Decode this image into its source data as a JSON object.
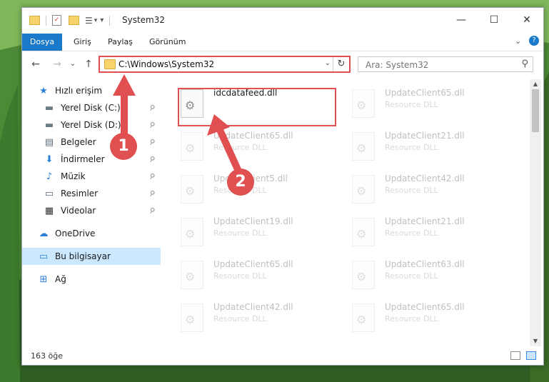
{
  "window": {
    "title": "System32",
    "controls": {
      "minimize": "—",
      "maximize": "☐",
      "close": "✕"
    }
  },
  "ribbon": {
    "tabs": [
      "Dosya",
      "Giriş",
      "Paylaş",
      "Görünüm"
    ],
    "expand_glyph": "⌄",
    "help_glyph": "?"
  },
  "address": {
    "path": "C:\\Windows\\System32",
    "dropdown_glyph": "⌄",
    "refresh_glyph": "↻"
  },
  "nav": {
    "back": "←",
    "forward": "→",
    "recent": "⌄",
    "up": "↑"
  },
  "search": {
    "placeholder": "Ara: System32",
    "icon": "⚲"
  },
  "sidebar": {
    "items": [
      {
        "label": "Hızlı erişim",
        "icon": "star-icon",
        "glyph": "★",
        "color": "#2b7fd6"
      },
      {
        "label": "Yerel Disk (C:)",
        "icon": "drive-icon",
        "glyph": "▬",
        "color": "#6b7b86",
        "pinned": true
      },
      {
        "label": "Yerel Disk (D:)",
        "icon": "drive-icon",
        "glyph": "▬",
        "color": "#6b7b86",
        "pinned": true
      },
      {
        "label": "Belgeler",
        "icon": "documents-icon",
        "glyph": "▤",
        "color": "#5a6b7a",
        "pinned": true
      },
      {
        "label": "İndirmeler",
        "icon": "download-icon",
        "glyph": "⬇",
        "color": "#2b7fd6",
        "pinned": true
      },
      {
        "label": "Müzik",
        "icon": "music-icon",
        "glyph": "♪",
        "color": "#2b7fd6",
        "pinned": true
      },
      {
        "label": "Resimler",
        "icon": "pictures-icon",
        "glyph": "▭",
        "color": "#5a6b7a",
        "pinned": true
      },
      {
        "label": "Videolar",
        "icon": "video-icon",
        "glyph": "▦",
        "color": "#333",
        "pinned": true
      },
      {
        "label": "OneDrive",
        "icon": "cloud-icon",
        "glyph": "☁",
        "color": "#2b7fd6"
      },
      {
        "label": "Bu bilgisayar",
        "icon": "computer-icon",
        "glyph": "▭",
        "color": "#2b7fd6",
        "selected": true
      },
      {
        "label": "Ağ",
        "icon": "network-icon",
        "glyph": "⊞",
        "color": "#2b7fd6"
      }
    ],
    "pin_glyph": "📌"
  },
  "files": [
    {
      "name": "idcdatafeed.dll",
      "type": "",
      "highlighted": true
    },
    {
      "name": "UpdateClient65.dll",
      "type": "Resource DLL"
    },
    {
      "name": "UpdateClient65.dll",
      "type": "Resource DLL"
    },
    {
      "name": "UpdateClient21.dll",
      "type": "Resource DLL"
    },
    {
      "name": "UpdateClient5.dll",
      "type": "Resource DLL"
    },
    {
      "name": "UpdateClient42.dll",
      "type": "Resource DLL"
    },
    {
      "name": "UpdateClient19.dll",
      "type": "Resource DLL"
    },
    {
      "name": "UpdateClient21.dll",
      "type": "Resource DLL"
    },
    {
      "name": "UpdateClient65.dll",
      "type": "Resource DLL"
    },
    {
      "name": "UpdateClient63.dll",
      "type": "Resource DLL"
    },
    {
      "name": "UpdateClient42.dll",
      "type": "Resource DLL"
    },
    {
      "name": "UpdateClient65.dll",
      "type": "Resource DLL"
    }
  ],
  "status": {
    "item_count": "163 öğe"
  },
  "callouts": {
    "one": "1",
    "two": "2"
  },
  "colors": {
    "accent": "#1979ca",
    "annotation": "#e05050",
    "selected": "#cce8ff"
  }
}
